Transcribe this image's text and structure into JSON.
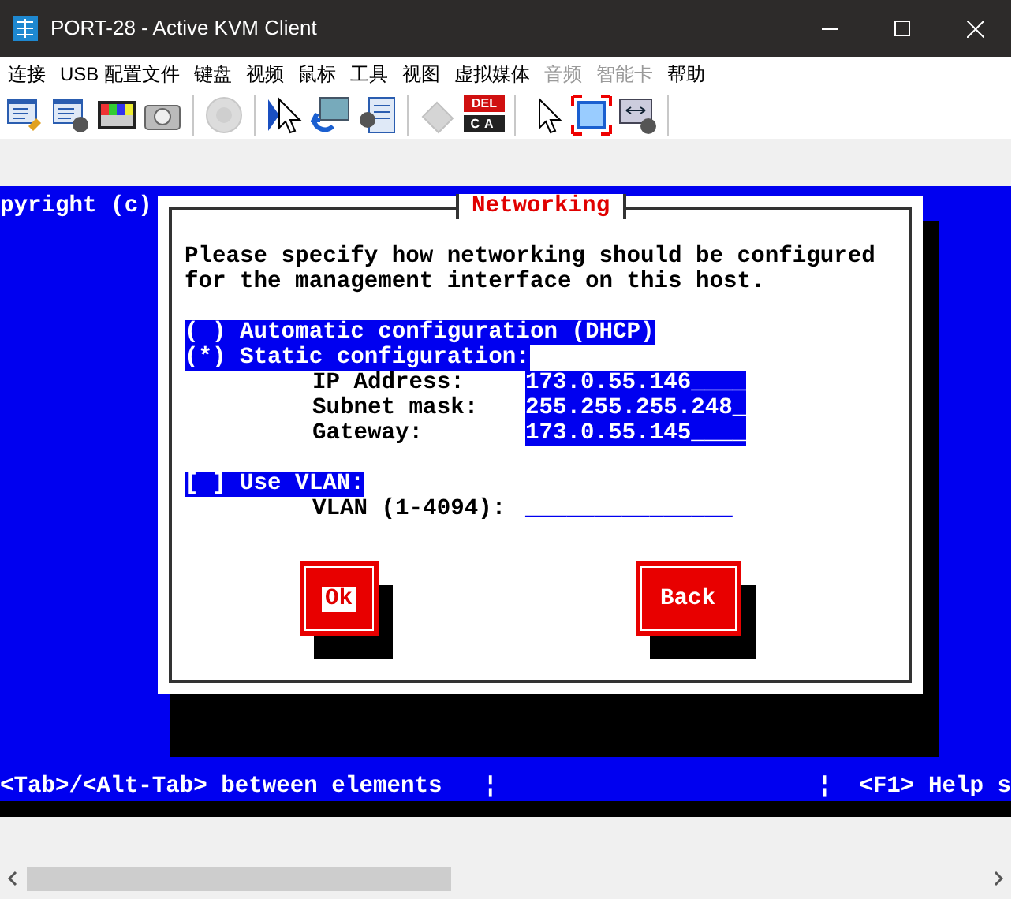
{
  "window": {
    "title": "PORT-28 - Active KVM Client"
  },
  "menu": [
    {
      "label": "连接",
      "disabled": false
    },
    {
      "label": "USB 配置文件",
      "disabled": false
    },
    {
      "label": "键盘",
      "disabled": false
    },
    {
      "label": "视频",
      "disabled": false
    },
    {
      "label": "鼠标",
      "disabled": false
    },
    {
      "label": "工具",
      "disabled": false
    },
    {
      "label": "视图",
      "disabled": false
    },
    {
      "label": "虚拟媒体",
      "disabled": false
    },
    {
      "label": "音频",
      "disabled": true
    },
    {
      "label": "智能卡",
      "disabled": true
    },
    {
      "label": "帮助",
      "disabled": false
    }
  ],
  "toolbar": [
    {
      "kind": "connect",
      "disabled": false
    },
    {
      "kind": "connect-camera",
      "disabled": false
    },
    {
      "kind": "color-bars",
      "disabled": false
    },
    {
      "kind": "camera",
      "disabled": false
    },
    {
      "kind": "separator"
    },
    {
      "kind": "speaker",
      "disabled": true
    },
    {
      "kind": "separator"
    },
    {
      "kind": "cursor-blue",
      "disabled": false
    },
    {
      "kind": "refresh-picture",
      "disabled": false
    },
    {
      "kind": "screen-camera",
      "disabled": false
    },
    {
      "kind": "separator"
    },
    {
      "kind": "plug",
      "disabled": true
    },
    {
      "kind": "del-keys",
      "disabled": false,
      "labels": [
        "DEL",
        "CA"
      ]
    },
    {
      "kind": "separator"
    },
    {
      "kind": "cursor",
      "disabled": false
    },
    {
      "kind": "fit-screen",
      "disabled": false
    },
    {
      "kind": "scale-camera",
      "disabled": false
    },
    {
      "kind": "separator"
    }
  ],
  "console": {
    "top_line": "pyright (c)",
    "dialog": {
      "title": "Networking",
      "prompt": [
        "Please specify how networking should be configured",
        "for the management interface on this host."
      ],
      "options": [
        {
          "label": "( ) Automatic configuration (DHCP)",
          "highlighted": true
        },
        {
          "label": "(*) Static configuration:",
          "highlighted": true
        }
      ],
      "fields": [
        {
          "label": "IP Address:",
          "value": "173.0.55.146____",
          "highlighted": true
        },
        {
          "label": "Subnet mask:",
          "value": "255.255.255.248_",
          "highlighted": true
        },
        {
          "label": "Gateway:",
          "value": "173.0.55.145____",
          "highlighted": true
        }
      ],
      "vlan_option": {
        "label": "[ ] Use VLAN:",
        "highlighted": true
      },
      "vlan_field": {
        "label": "VLAN (1-4094):",
        "value": "_______________",
        "highlighted": false
      },
      "buttons": [
        {
          "label": "Ok",
          "selected": true
        },
        {
          "label": "Back",
          "selected": false
        }
      ]
    },
    "status_bar": [
      "<Tab>/<Alt-Tab> between elements   ¦",
      "¦  <F1> Help s"
    ]
  }
}
